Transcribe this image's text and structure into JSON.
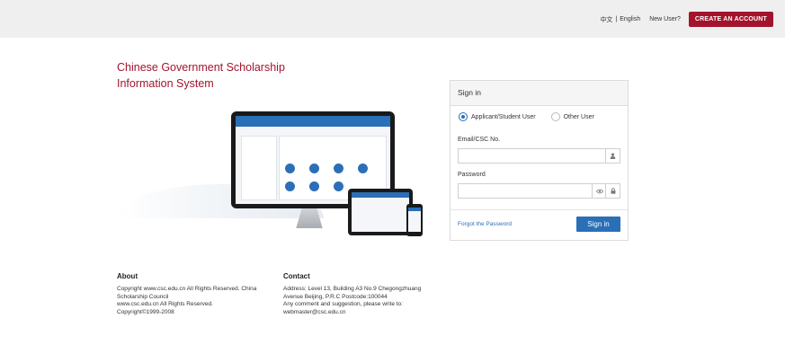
{
  "header": {
    "lang_zh": "中文",
    "lang_sep": "|",
    "lang_en": "English",
    "new_user": "New User?",
    "create_account": "CREATE AN ACCOUNT"
  },
  "title": {
    "line1": "Chinese Government Scholarship",
    "line2": "Information System"
  },
  "signin": {
    "heading": "Sign in",
    "radio_applicant": "Applicant/Student User",
    "radio_other": "Other User",
    "email_label": "Email/CSC No.",
    "email_value": "",
    "password_label": "Password",
    "password_value": "",
    "forgot": "Forgot the Password",
    "button": "Sign in"
  },
  "footer": {
    "about_heading": "About",
    "about_lines": [
      "Copyright www.csc.edu.cn All Rights Reserved. China",
      "Scholarship Council",
      "www.csc.edu.cn All Rights Reserved.",
      "Copyright©1999-2008"
    ],
    "contact_heading": "Contact",
    "contact_lines": [
      "Address: Level 13, Building A3 No.9 Chegongzhuang",
      "Avenue Beijing, P.R.C Postcode:100044",
      "Any comment and suggestion, please write to:",
      "webmaster@csc.edu.cn"
    ]
  },
  "icons": {
    "user": "user-icon",
    "eye": "eye-icon",
    "lock": "lock-icon"
  },
  "colors": {
    "brand_red": "#a3142c",
    "primary_blue": "#2b6fb6"
  }
}
